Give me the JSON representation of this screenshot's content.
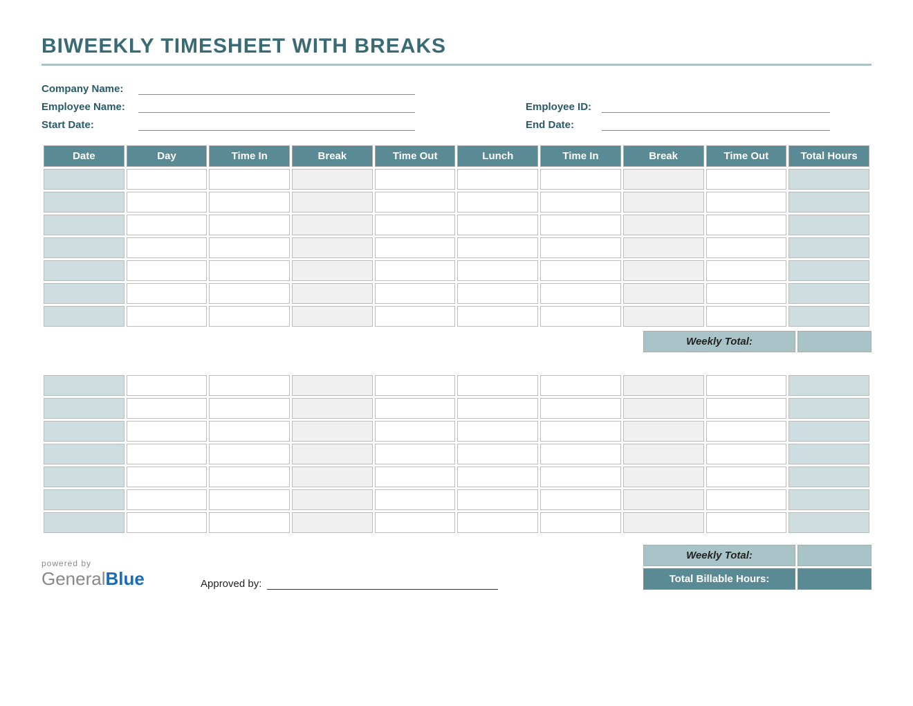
{
  "title": "BIWEEKLY TIMESHEET WITH BREAKS",
  "meta": {
    "company_label": "Company Name:",
    "employee_label": "Employee Name:",
    "employee_id_label": "Employee ID:",
    "start_date_label": "Start Date:",
    "end_date_label": "End Date:"
  },
  "columns": [
    "Date",
    "Day",
    "Time In",
    "Break",
    "Time Out",
    "Lunch",
    "Time In",
    "Break",
    "Time Out",
    "Total Hours"
  ],
  "week1_rows": 7,
  "week2_rows": 7,
  "weekly_total_label": "Weekly Total:",
  "billable_label": "Total Billable Hours:",
  "footer": {
    "powered_by": "powered by",
    "logo_1": "General",
    "logo_2": "Blue",
    "approved_label": "Approved by:"
  },
  "shading": {
    "col_shaded": [
      0,
      9
    ],
    "col_light": [
      3,
      7
    ]
  }
}
